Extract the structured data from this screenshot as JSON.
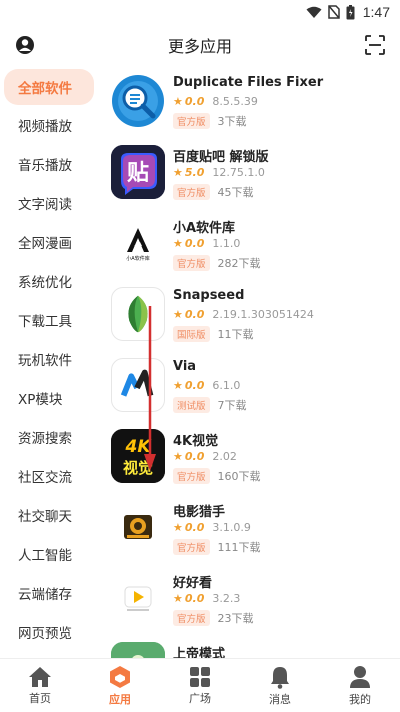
{
  "status_bar": {
    "time": "1:47"
  },
  "header": {
    "title": "更多应用"
  },
  "sidebar": {
    "items": [
      {
        "label": "全部软件",
        "active": true
      },
      {
        "label": "视频播放"
      },
      {
        "label": "音乐播放"
      },
      {
        "label": "文字阅读"
      },
      {
        "label": "全网漫画"
      },
      {
        "label": "系统优化"
      },
      {
        "label": "下载工具"
      },
      {
        "label": "玩机软件"
      },
      {
        "label": "XP模块"
      },
      {
        "label": "资源搜索"
      },
      {
        "label": "社区交流"
      },
      {
        "label": "社交聊天"
      },
      {
        "label": "人工智能"
      },
      {
        "label": "云端储存"
      },
      {
        "label": "网页预览"
      }
    ]
  },
  "apps": [
    {
      "name": "Duplicate Files Fixer",
      "rating": "0.0",
      "version": "8.5.5.39",
      "badge": "官方版",
      "downloads": "3下载",
      "icon": "magnifier-icon"
    },
    {
      "name": "百度贴吧 解锁版",
      "rating": "5.0",
      "version": "12.75.1.0",
      "badge": "官方版",
      "downloads": "45下载",
      "icon": "tieba-icon",
      "icon_text": "贴"
    },
    {
      "name": "小A软件库",
      "rating": "0.0",
      "version": "1.1.0",
      "badge": "官方版",
      "downloads": "282下载",
      "icon": "letter-a-icon",
      "icon_text": "小A软件库"
    },
    {
      "name": "Snapseed",
      "rating": "0.0",
      "version": "2.19.1.303051424",
      "badge": "国际版",
      "downloads": "11下载",
      "icon": "leaf-icon"
    },
    {
      "name": "Via",
      "rating": "0.0",
      "version": "6.1.0",
      "badge": "测试版",
      "downloads": "7下载",
      "icon": "via-icon"
    },
    {
      "name": "4K视觉",
      "rating": "0.0",
      "version": "2.02",
      "badge": "官方版",
      "downloads": "160下载",
      "icon": "4k-icon",
      "icon_text": "4K",
      "icon_text2": "视觉"
    },
    {
      "name": "电影猎手",
      "rating": "0.0",
      "version": "3.1.0.9",
      "badge": "官方版",
      "downloads": "111下载",
      "icon": "film-icon"
    },
    {
      "name": "好好看",
      "rating": "0.0",
      "version": "3.2.3",
      "badge": "官方版",
      "downloads": "23下载",
      "icon": "play-icon"
    },
    {
      "name": "上帝模式",
      "rating": "",
      "version": "",
      "badge": "",
      "downloads": "",
      "icon": "god-mode-icon"
    }
  ],
  "bottom_nav": [
    {
      "label": "首页",
      "icon": "home-icon"
    },
    {
      "label": "应用",
      "icon": "apps-cube-icon",
      "active": true
    },
    {
      "label": "广场",
      "icon": "grid-icon"
    },
    {
      "label": "消息",
      "icon": "bell-icon"
    },
    {
      "label": "我的",
      "icon": "person-icon"
    }
  ],
  "colors": {
    "accent": "#f47a42",
    "badge_bg": "#fdebe3",
    "star": "#f0a030"
  }
}
